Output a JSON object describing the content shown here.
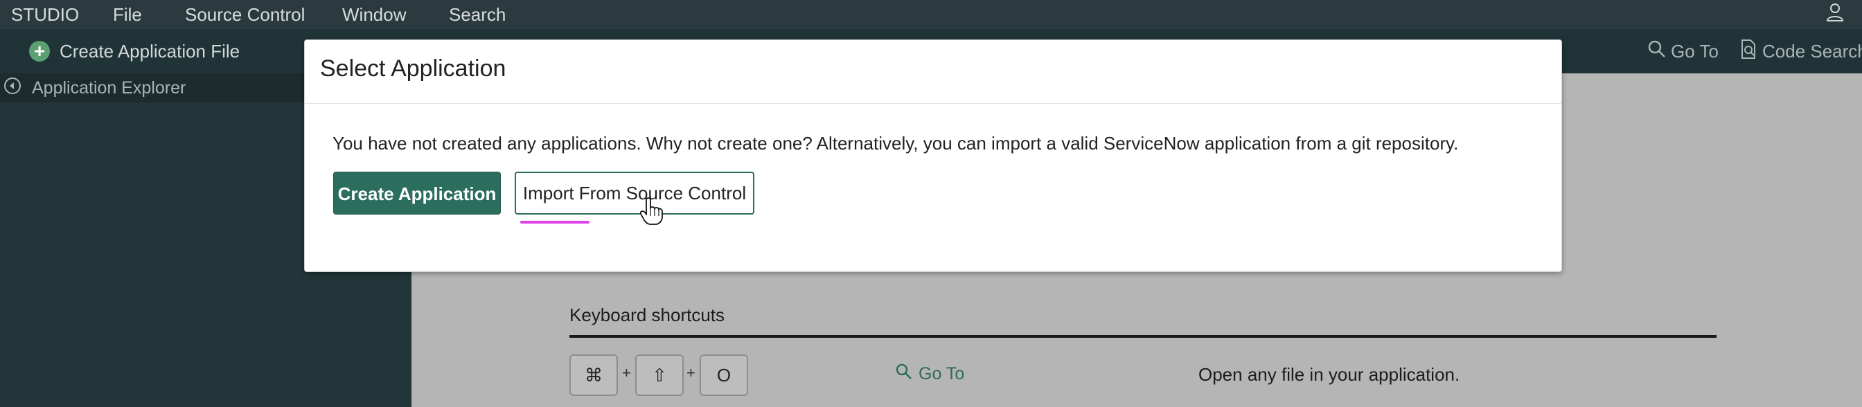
{
  "menubar": {
    "brand": "STUDIO",
    "items": [
      "File",
      "Source Control",
      "Window",
      "Search"
    ]
  },
  "toolbar": {
    "create_file_label": "Create Application File",
    "goto_label": "Go To",
    "code_search_label": "Code Search"
  },
  "explorer": {
    "title": "Application Explorer"
  },
  "modal": {
    "title": "Select Application",
    "message": "You have not created any applications. Why not create one? Alternatively, you can import a valid ServiceNow application from a git repository.",
    "create_button": "Create Application",
    "import_button": "Import From Source Control"
  },
  "shortcuts": {
    "title": "Keyboard shortcuts",
    "keys": [
      "⌘",
      "⇧",
      "O"
    ],
    "plus": "+",
    "action_label": "Go To",
    "description": "Open any file in your application."
  },
  "colors": {
    "menubar_bg": "#2b3a3e",
    "toolbar_bg": "#203337",
    "sidebar_bg": "#223538",
    "primary_button": "#2c6e5e",
    "focus_underline": "#e040e8",
    "link": "#2e6d55"
  }
}
